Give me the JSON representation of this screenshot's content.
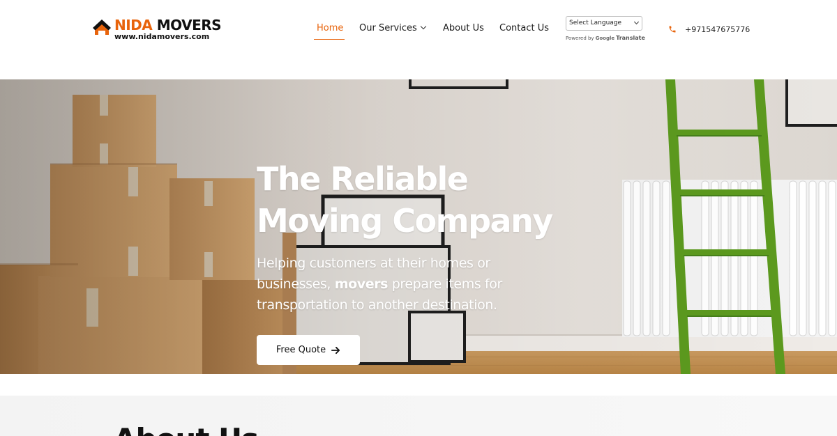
{
  "brand": {
    "name_accent": "NIDA",
    "name_main": "MOVERS",
    "website": "www.nidamovers.com",
    "accent_color": "#e8640c"
  },
  "nav": {
    "items": [
      {
        "label": "Home",
        "active": true
      },
      {
        "label": "Our Services",
        "has_dropdown": true
      },
      {
        "label": "About Us"
      },
      {
        "label": "Contact Us"
      }
    ]
  },
  "translate": {
    "select_label": "Select Language",
    "powered_by": "Powered by",
    "google": "Google",
    "translate": "Translate"
  },
  "contact": {
    "phone": "+971547675776",
    "icon": "phone-icon"
  },
  "hero": {
    "title_line1": "The Reliable",
    "title_line2": "Moving Company",
    "subtitle_part1": "Helping customers at their homes or businesses, ",
    "subtitle_bold": "movers",
    "subtitle_part2": " prepare items for transportation to another destination.",
    "cta_label": "Free Quote",
    "cta_icon": "arrow-right-icon"
  },
  "about": {
    "heading": "About Us"
  }
}
